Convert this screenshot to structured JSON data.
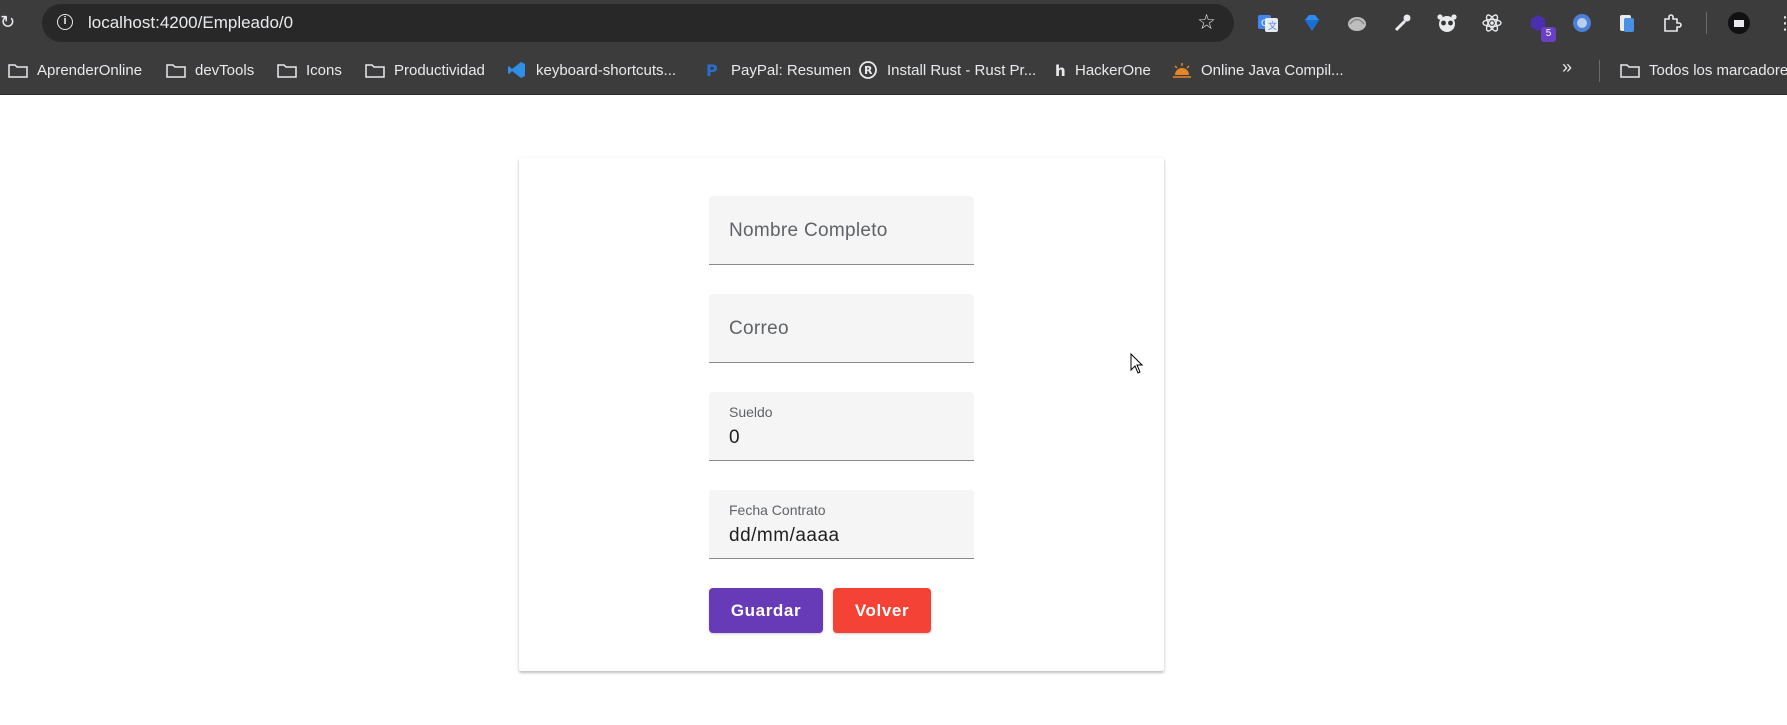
{
  "browser": {
    "url": "localhost:4200/Empleado/0",
    "extensions": [
      {
        "icon": "google-translate-icon"
      },
      {
        "icon": "gem-icon"
      },
      {
        "icon": "shell-icon"
      },
      {
        "icon": "eyedropper-icon"
      },
      {
        "icon": "panda-icon"
      },
      {
        "icon": "react-icon"
      },
      {
        "icon": "hexagon-extension-icon",
        "badge": "5"
      },
      {
        "icon": "circle-extension-icon"
      },
      {
        "icon": "clipboard-icon"
      },
      {
        "icon": "puzzle-icon"
      },
      {
        "icon": "profile-avatar-icon"
      }
    ]
  },
  "bookmarks": {
    "items": [
      {
        "label": "AprenderOnline",
        "icon": "folder-icon"
      },
      {
        "label": "devTools",
        "icon": "folder-icon"
      },
      {
        "label": "Icons",
        "icon": "folder-icon"
      },
      {
        "label": "Productividad",
        "icon": "folder-icon"
      },
      {
        "label": "keyboard-shortcuts...",
        "icon": "vscode-icon"
      },
      {
        "label": "PayPal: Resumen",
        "icon": "paypal-icon"
      },
      {
        "label": "Install Rust - Rust Pr...",
        "icon": "rust-icon"
      },
      {
        "label": "HackerOne",
        "icon": "hackerone-icon"
      },
      {
        "label": "Online Java Compil...",
        "icon": "sun-icon"
      }
    ],
    "overflow": "»",
    "all_bookmarks": "Todos los marcadores"
  },
  "form": {
    "nombre_placeholder": "Nombre Completo",
    "correo_placeholder": "Correo",
    "sueldo_label": "Sueldo",
    "sueldo_value": "0",
    "fecha_label": "Fecha Contrato",
    "fecha_value": "dd/mm/aaaa",
    "save_label": "Guardar",
    "back_label": "Volver"
  },
  "colors": {
    "primary": "#673ab7",
    "warn": "#f44336"
  }
}
